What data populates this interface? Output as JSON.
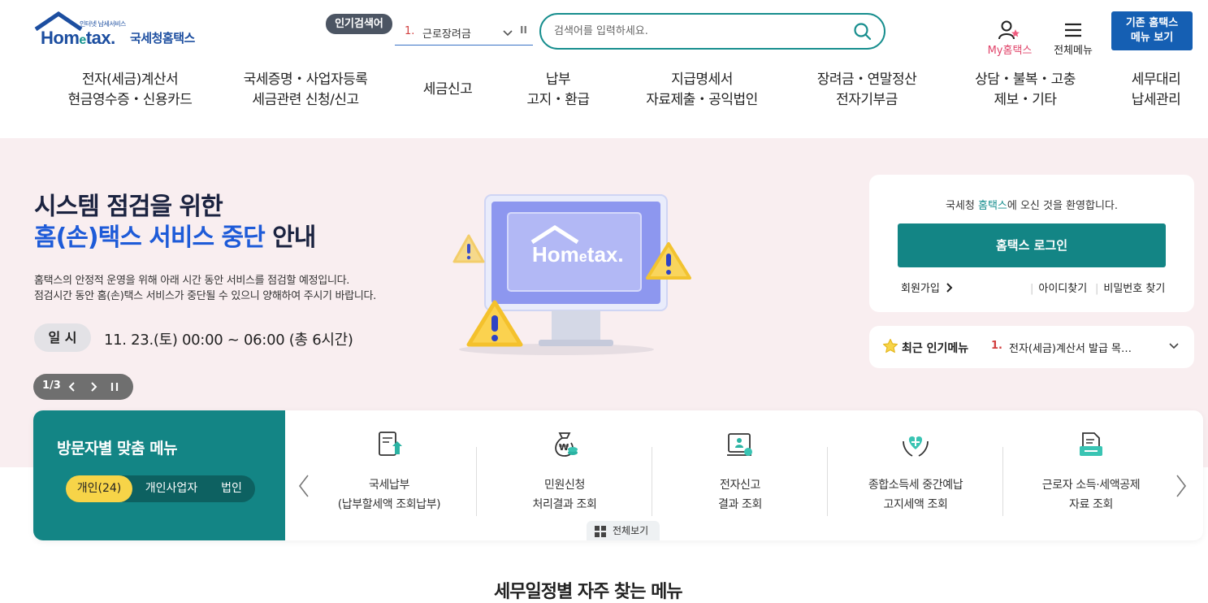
{
  "header": {
    "logo_tagline": "인터넷 납세서비스",
    "logo_word_a": "Hom",
    "logo_word_e": "e",
    "logo_word_b": "tax.",
    "logo_kr": "국세청홈택스",
    "popular_badge": "인기검색어",
    "popular_rank": "1.",
    "popular_term": "근로장려금",
    "search_placeholder": "검색어를 입력하세요.",
    "my_hometax": "My홈택스",
    "all_menu": "전체메뉴",
    "old_menu_line1": "기존 홈택스",
    "old_menu_line2": "메뉴 보기"
  },
  "gnb": [
    {
      "l1": "전자(세금)계산서",
      "l2": "현금영수증・신용카드"
    },
    {
      "l1": "국세증명・사업자등록",
      "l2": "세금관련 신청/신고"
    },
    {
      "l1": "세금신고",
      "l2": ""
    },
    {
      "l1": "납부",
      "l2": "고지・환급"
    },
    {
      "l1": "지급명세서",
      "l2": "자료제출・공익법인"
    },
    {
      "l1": "장려금・연말정산",
      "l2": "전자기부금"
    },
    {
      "l1": "상담・불복・고충",
      "l2": "제보・기타"
    },
    {
      "l1": "세무대리",
      "l2": "납세관리"
    }
  ],
  "hero": {
    "title_line1": "시스템 점검을 위한",
    "title_hl": "홈(손)택스 서비스 중단",
    "title_tail": " 안내",
    "desc_line1": "홈택스의 안정적 운영을 위해 아래 시간 동안 서비스를 점검할 예정입니다.",
    "desc_line2": "점검시간 동안 홈(손)택스 서비스가 중단될 수 있으니 양해하여 주시기 바랍니다.",
    "date_chip": "일 시",
    "date_text": "11. 23.(토) 00:00 ~ 06:00 (총 6시간)",
    "pager_count": "1/3",
    "illus_logo_a": "Hom",
    "illus_logo_e": "e",
    "illus_logo_b": "tax."
  },
  "login": {
    "welcome_pre": "국세청 ",
    "welcome_hl": "홈택스",
    "welcome_post": "에 오신 것을 환영합니다.",
    "login_button": "홈택스 로그인",
    "join": "회원가입",
    "find_id": "아이디찾기",
    "find_pw": "비밀번호 찾기"
  },
  "recent": {
    "label": "최근 인기메뉴",
    "rank": "1.",
    "item": "전자(세금)계산서 발급 목…"
  },
  "visitor": {
    "title": "방문자별 맞춤 메뉴",
    "tabs": [
      "개인(24)",
      "개인사업자",
      "법인"
    ],
    "items": [
      {
        "icon": "tax-payment-icon",
        "l1": "국세납부",
        "l2": "(납부할세액 조회납부)"
      },
      {
        "icon": "money-bag-icon",
        "l1": "민원신청",
        "l2": "처리결과 조회"
      },
      {
        "icon": "e-filing-icon",
        "l1": "전자신고",
        "l2": "결과 조회"
      },
      {
        "icon": "heart-hands-icon",
        "l1": "종합소득세 중간예납",
        "l2": "고지세액 조회"
      },
      {
        "icon": "document-folder-icon",
        "l1": "근로자 소득·세액공제",
        "l2": "자료 조회"
      }
    ],
    "view_all": "전체보기"
  },
  "bottom": {
    "title_partial": "세무일정별 자주 찾는 메뉴"
  },
  "colors": {
    "teal": "#138585",
    "navy": "#1c4ea0",
    "blue_button": "#155fb3",
    "hero_bg": "#f9eef0",
    "accent_red": "#d23f3f",
    "yellow": "#f7d448"
  }
}
